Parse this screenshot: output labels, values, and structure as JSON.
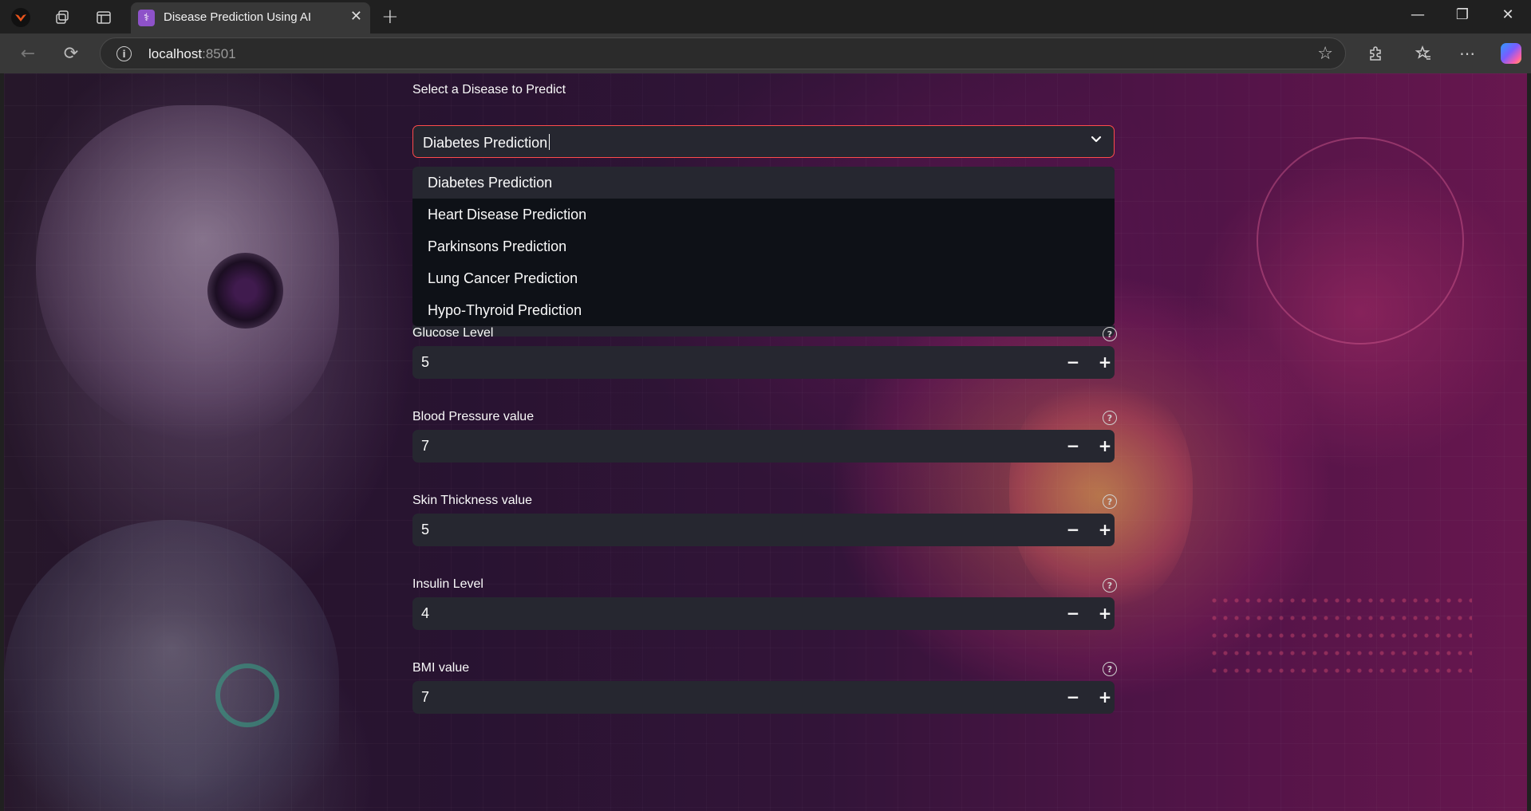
{
  "browser": {
    "tab_title": "Disease Prediction Using AI",
    "tab_favicon": "⚕",
    "tab_close": "✕",
    "new_tab": "+",
    "window_controls": {
      "minimize": "—",
      "maximize": "❐",
      "close": "✕"
    },
    "address": {
      "host": "localhost",
      "port": ":8501"
    },
    "icons": {
      "back": "←",
      "reload": "⟳",
      "info": "i",
      "star": "☆",
      "extensions": "⚙",
      "favorites": "✩",
      "more": "⋯"
    }
  },
  "form": {
    "select_label": "Select a Disease to Predict",
    "select_value": "Diabetes Prediction",
    "chevron": "⌄",
    "options": [
      "Diabetes Prediction",
      "Heart Disease Prediction",
      "Parkinsons Prediction",
      "Lung Cancer Prediction",
      "Hypo-Thyroid Prediction"
    ],
    "fields": [
      {
        "label": "Glucose Level",
        "value": "5"
      },
      {
        "label": "Blood Pressure value",
        "value": "7"
      },
      {
        "label": "Skin Thickness value",
        "value": "5"
      },
      {
        "label": "Insulin Level",
        "value": "4"
      },
      {
        "label": "BMI value",
        "value": "7"
      }
    ],
    "step_minus": "−",
    "step_plus": "+",
    "help_glyph": "?"
  },
  "colors": {
    "accent": "#ff4b4b",
    "input_bg": "#262730",
    "menu_bg": "#0e1117",
    "text": "#fafafa"
  }
}
